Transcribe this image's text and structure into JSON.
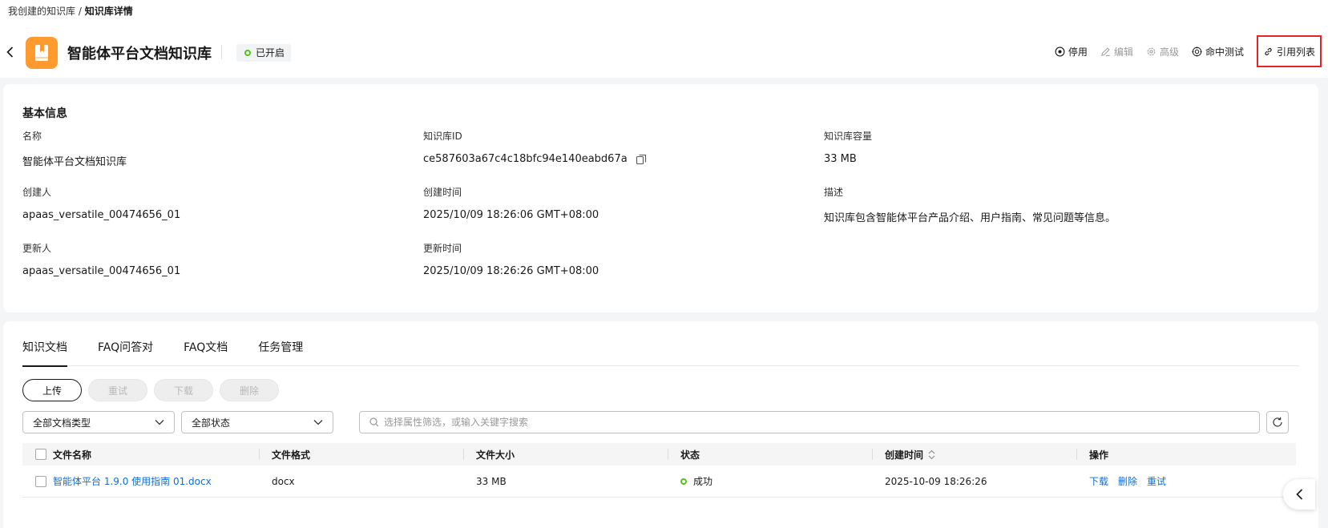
{
  "breadcrumb": {
    "parent": "我创建的知识库",
    "separator": " / ",
    "current": "知识库详情"
  },
  "header": {
    "title": "智能体平台文档知识库",
    "status": "已开启",
    "actions": {
      "disable": "停用",
      "edit": "编辑",
      "advanced": "高级",
      "hit_test": "命中测试",
      "reference_list": "引用列表"
    }
  },
  "basic_info": {
    "title": "基本信息",
    "name_label": "名称",
    "name_value": "智能体平台文档知识库",
    "id_label": "知识库ID",
    "id_value": "ce587603a67c4c18bfc94e140eabd67a",
    "capacity_label": "知识库容量",
    "capacity_value": "33 MB",
    "creator_label": "创建人",
    "creator_value": "apaas_versatile_00474656_01",
    "created_label": "创建时间",
    "created_value": "2025/10/09 18:26:06 GMT+08:00",
    "desc_label": "描述",
    "desc_value": "知识库包含智能体平台产品介绍、用户指南、常见问题等信息。",
    "updater_label": "更新人",
    "updater_value": "apaas_versatile_00474656_01",
    "updated_label": "更新时间",
    "updated_value": "2025/10/09 18:26:26 GMT+08:00"
  },
  "tabs": [
    "知识文档",
    "FAQ问答对",
    "FAQ文档",
    "任务管理"
  ],
  "buttons": {
    "upload": "上传",
    "retry": "重试",
    "download": "下载",
    "delete": "删除"
  },
  "filters": {
    "doc_type": "全部文档类型",
    "status": "全部状态",
    "search_placeholder": "选择属性筛选，或输入关键字搜索"
  },
  "table": {
    "columns": [
      "文件名称",
      "文件格式",
      "文件大小",
      "状态",
      "创建时间",
      "操作"
    ],
    "rows": [
      {
        "name": "智能体平台 1.9.0 使用指南 01.docx",
        "format": "docx",
        "size": "33 MB",
        "status": "成功",
        "created": "2025-10-09 18:26:26",
        "ops": [
          "下载",
          "删除",
          "重试"
        ]
      }
    ]
  },
  "colors": {
    "accent": "#0c6fd8",
    "success": "#52c41a",
    "kb_icon": "#ff9a2e",
    "highlight_border": "#e0252b"
  }
}
